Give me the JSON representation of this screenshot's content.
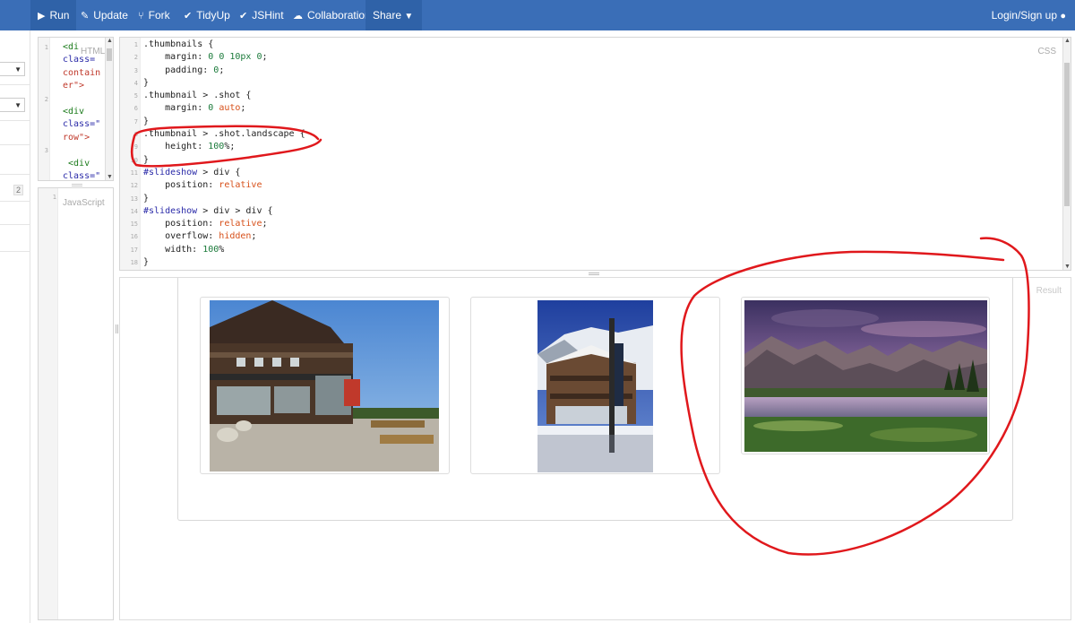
{
  "toolbar": {
    "run": "Run",
    "update": "Update",
    "fork": "Fork",
    "tidyup": "TidyUp",
    "jshint": "JSHint",
    "collaboration": "Collaboration",
    "share": "Share",
    "login": "Login/Sign up"
  },
  "sidebar": {
    "badge": "2"
  },
  "panels": {
    "html_label": "HTML",
    "css_label": "CSS",
    "js_label": "JavaScript",
    "result_label": "Result"
  },
  "html_code": [
    {
      "n": "1",
      "t": "<di"
    },
    {
      "n": "",
      "t": "class="
    },
    {
      "n": "",
      "t": "contain"
    },
    {
      "n": "",
      "t": "er\">"
    },
    {
      "n": "2",
      "t": ""
    },
    {
      "n": "",
      "t": "<div"
    },
    {
      "n": "",
      "t": "class=\""
    },
    {
      "n": "",
      "t": "row\">"
    },
    {
      "n": "3",
      "t": ""
    },
    {
      "n": "",
      "t": " <div"
    },
    {
      "n": "",
      "t": "class=\""
    }
  ],
  "js_code": [
    {
      "n": "1"
    }
  ],
  "css_code": [
    {
      "n": "1",
      "t": ".thumbnails {"
    },
    {
      "n": "2",
      "t": "    margin: 0 0 10px 0;"
    },
    {
      "n": "3",
      "t": "    padding: 0;"
    },
    {
      "n": "4",
      "t": "}"
    },
    {
      "n": "5",
      "t": ".thumbnail > .shot {"
    },
    {
      "n": "6",
      "t": "    margin: 0 auto;"
    },
    {
      "n": "7",
      "t": "}"
    },
    {
      "n": "8",
      "t": ".thumbnail > .shot.landscape {"
    },
    {
      "n": "9",
      "t": "    height: 100%;"
    },
    {
      "n": "10",
      "t": "}"
    },
    {
      "n": "11",
      "t": "#slideshow > div {"
    },
    {
      "n": "12",
      "t": "    position: relative"
    },
    {
      "n": "13",
      "t": "}"
    },
    {
      "n": "14",
      "t": "#slideshow > div > div {"
    },
    {
      "n": "15",
      "t": "    position: relative;"
    },
    {
      "n": "16",
      "t": "    overflow: hidden;"
    },
    {
      "n": "17",
      "t": "    width: 100%"
    },
    {
      "n": "18",
      "t": "}"
    }
  ],
  "colors": {
    "toolbar_bg": "#3a6eb7",
    "toolbar_active": "#2f62a8",
    "annotation": "#e0181c"
  }
}
